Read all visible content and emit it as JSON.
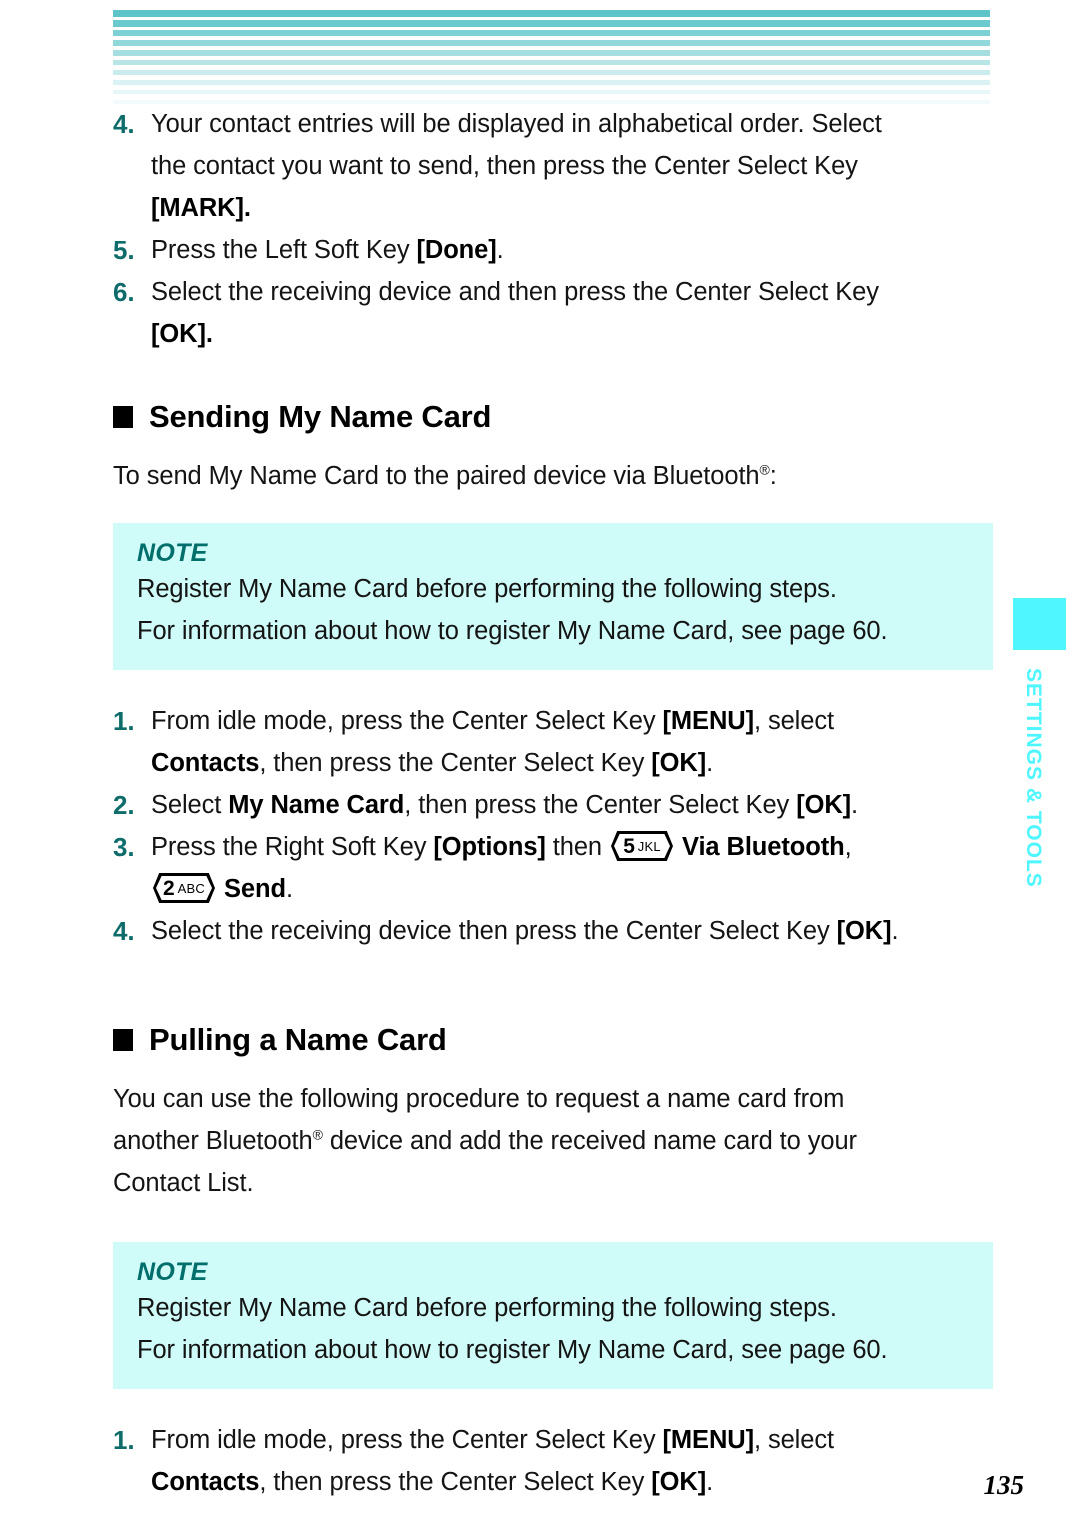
{
  "document": {
    "page_number": "135",
    "side_tab_label": "SETTINGS & TOOLS",
    "accent_teal": "#0E6C6B",
    "note_bg": "#CFFBF8",
    "side_tab_color": "#4FF6FF"
  },
  "top_steps": [
    {
      "num": "4.",
      "lines": [
        "Your contact entries will be displayed in alphabetical order. Select",
        "the contact you want to send, then press the Center Select Key",
        "[MARK]."
      ]
    },
    {
      "num": "5.",
      "lines": [
        "Press the Left Soft Key [Done]."
      ]
    },
    {
      "num": "6.",
      "lines": [
        "Select the receiving device and then press the Center Select Key",
        "[OK]."
      ]
    }
  ],
  "section_sending": {
    "heading": "Sending My Name Card",
    "intro_pre": "To send My Name Card to the paired device via Bluetooth",
    "intro_reg": "®",
    "intro_post": ":",
    "steps": [
      {
        "num": "1.",
        "line1_pre": "From idle mode, press the Center Select Key ",
        "line1_bold": "[MENU]",
        "line1_post": ", select",
        "line2_bold": "Contacts",
        "line2_mid": ", then press the Center Select Key ",
        "line2_bold2": "[OK]",
        "line2_post": "."
      },
      {
        "num": "2.",
        "line1_pre": "Select ",
        "line1_bold": "My Name Card",
        "line1_mid": ", then press the Center Select Key ",
        "line1_bold2": "[OK]",
        "line1_post": "."
      },
      {
        "num": "3.",
        "line1_pre": "Press the Right Soft Key ",
        "line1_bold": "[Options]",
        "line1_mid": " then ",
        "key1_digit": "5",
        "key1_letters": "JKL",
        "line1_bold2": "Via Bluetooth",
        "line1_post": ",",
        "key2_digit": "2",
        "key2_letters": "ABC",
        "line2_bold": "Send",
        "line2_post": "."
      },
      {
        "num": "4.",
        "line1_pre": "Select the receiving device then press the Center Select Key ",
        "line1_bold": "[OK]",
        "line1_post": "."
      }
    ]
  },
  "section_pulling": {
    "heading": "Pulling a Name Card",
    "body_line1": "You can use the following procedure to request a name card from",
    "body_line2_pre": "another Bluetooth",
    "body_line2_reg": "®",
    "body_line2_post": " device and add the received name card to your",
    "body_line3": "Contact List.",
    "steps": [
      {
        "num": "1.",
        "line1_pre": "From idle mode, press the Center Select Key ",
        "line1_bold": "[MENU]",
        "line1_post": ", select",
        "line2_bold": "Contacts",
        "line2_mid": ", then press the Center Select Key ",
        "line2_bold2": "[OK]",
        "line2_post": "."
      }
    ]
  },
  "note_box_1": {
    "label": "NOTE",
    "line1": "Register My Name Card before performing the following steps.",
    "line2": "For information about how to register My Name Card, see page 60."
  },
  "note_box_2": {
    "label": "NOTE",
    "line1": "Register My Name Card before performing the following steps.",
    "line2": "For information about how to register My Name Card, see page 60."
  }
}
